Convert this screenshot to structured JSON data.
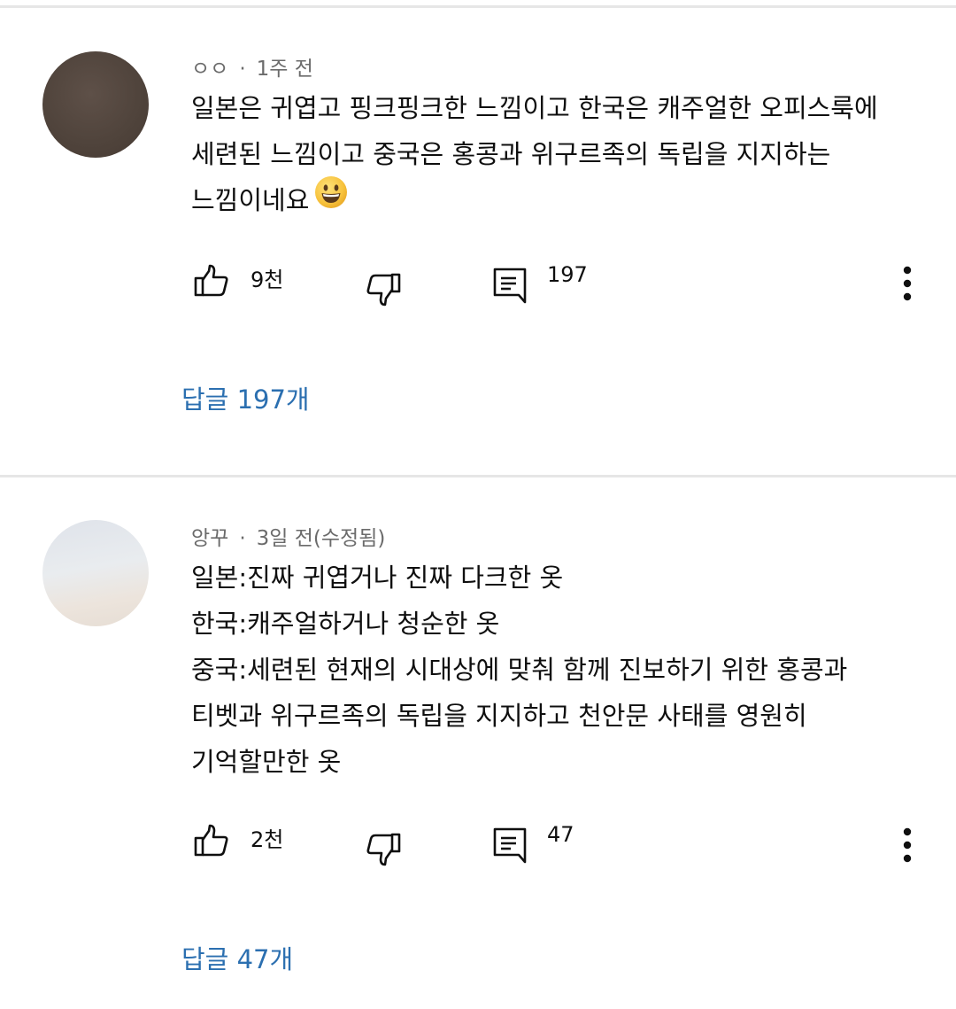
{
  "comments": [
    {
      "author": "ㅇㅇ",
      "time": "1주 전",
      "lines": [
        "일본은 귀엽고 핑크핑크한 느낌이고 한국은 캐주얼한 오피스룩에",
        "세련된 느낌이고 중국은 홍콩과 위구르족의 독립을 지지하는",
        "느낌이네요"
      ],
      "emoji": "grinning-face",
      "likes": "9천",
      "reply_count": "197",
      "replies_label": "답글 197개"
    },
    {
      "author": "앙꾸",
      "time": "3일 전(수정됨)",
      "lines": [
        "일본:진짜 귀엽거나 진짜 다크한 옷",
        "한국:캐주얼하거나 청순한 옷",
        "중국:세련된 현재의 시대상에 맞춰 함께 진보하기 위한 홍콩과",
        "티벳과 위구르족의 독립을 지지하고 천안문 사태를 영원히",
        "기억할만한 옷"
      ],
      "likes": "2천",
      "reply_count": "47",
      "replies_label": "답글 47개"
    }
  ],
  "separator": "·",
  "icons": {
    "like": "thumbs-up-icon",
    "dislike": "thumbs-down-icon",
    "reply": "comment-icon",
    "more": "more-vertical-icon"
  },
  "colors": {
    "link": "#2b6fb0",
    "meta": "#6b6b6b",
    "text": "#0f0f0f",
    "divider": "#e6e6e6"
  }
}
